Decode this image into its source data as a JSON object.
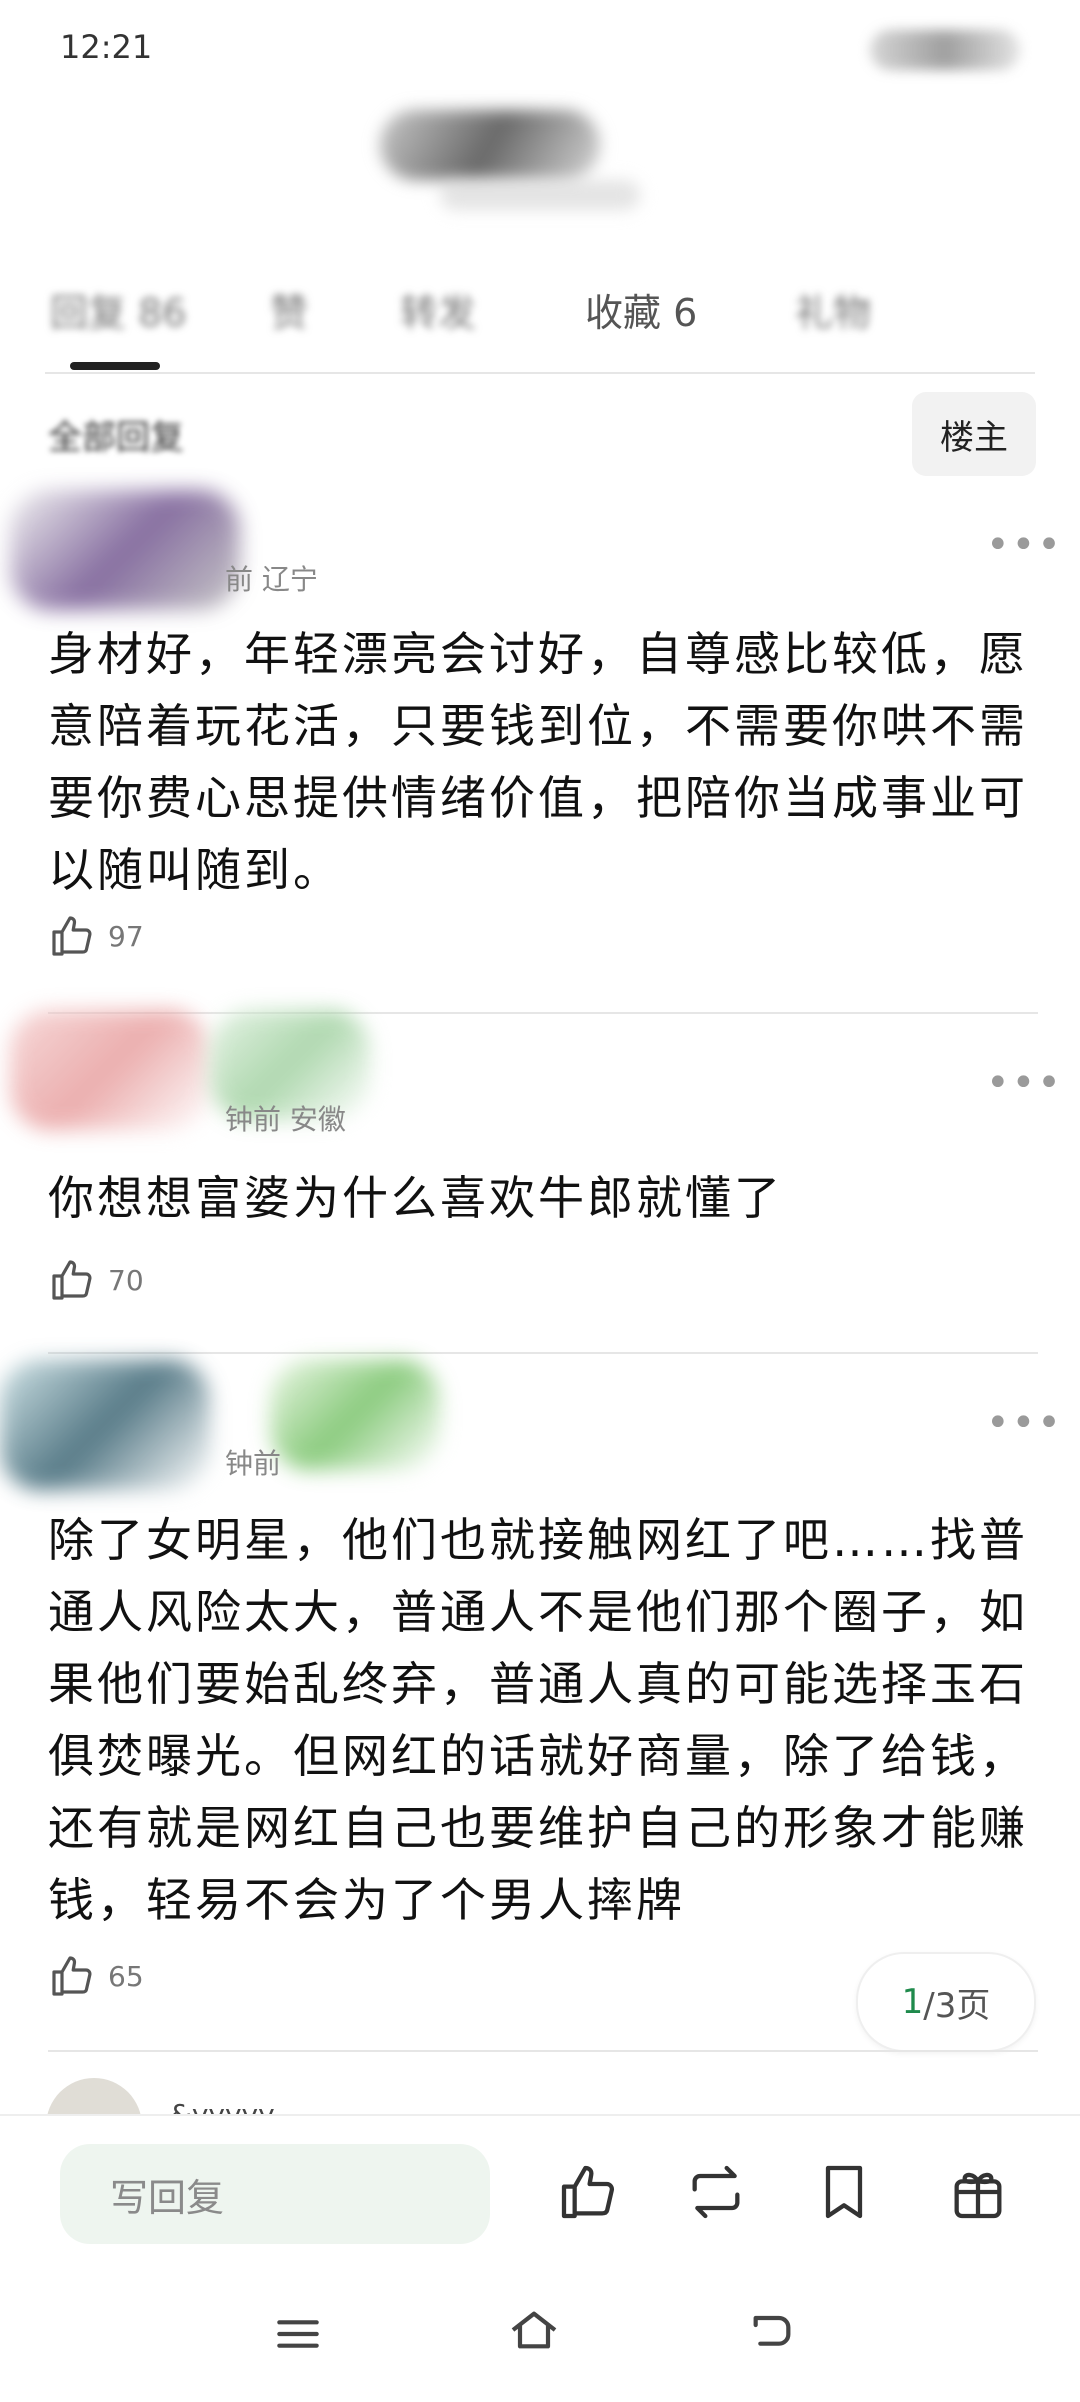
{
  "status": {
    "time": "12:21"
  },
  "tabs": [
    "回复 86",
    "赞",
    "转发",
    "收藏 6",
    "礼物"
  ],
  "filter": {
    "all_replies": "全部回复",
    "owner_button": "楼主"
  },
  "comments": [
    {
      "meta": "前 辽宁",
      "text": "身材好，年轻漂亮会讨好，自尊感比较低，愿意陪着玩花活，只要钱到位，不需要你哄不需要你费心思提供情绪价值，把陪你当成事业可以随叫随到。",
      "likes": "97"
    },
    {
      "meta": "钟前 安徽",
      "text": "你想想富婆为什么喜欢牛郎就懂了",
      "likes": "70"
    },
    {
      "meta": "钟前",
      "text": "除了女明星，他们也就接触网红了吧……找普通人风险太大，普通人不是他们那个圈子，如果他们要始乱终弃，普通人真的可能选择玉石俱焚曝光。但网红的话就好商量，除了给钱，还有就是网红自己也要维护自己的形象才能赚钱，轻易不会为了个男人摔牌",
      "likes": "65"
    }
  ],
  "pagination": {
    "current": "1",
    "total": "/3页"
  },
  "next_comment": {
    "name": "&yyyyy"
  },
  "bottom": {
    "reply_placeholder": "写回复"
  },
  "icons": [
    "thumbs-up",
    "repost",
    "bookmark",
    "gift",
    "menu",
    "home",
    "back"
  ]
}
